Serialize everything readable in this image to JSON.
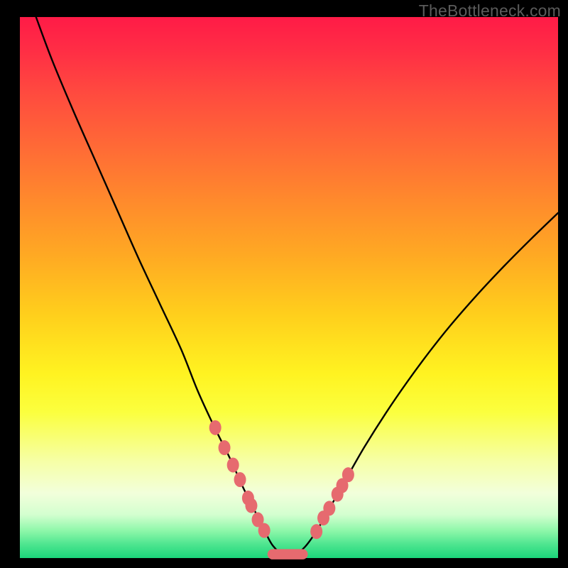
{
  "watermark": "TheBottleneck.com",
  "colors": {
    "background": "#000000",
    "curve_stroke": "#000000",
    "marker_fill": "#e66a6f",
    "gradient_stops": [
      "#ff1b47",
      "#ff2d45",
      "#ff4a3f",
      "#ff6a36",
      "#ff8a2c",
      "#ffa923",
      "#ffcf1c",
      "#fff321",
      "#fbff3e",
      "#f6ffa5",
      "#f2ffdb",
      "#d3ffcf",
      "#8cf7a9",
      "#4de58f",
      "#1bd67a"
    ]
  },
  "chart_data": {
    "type": "line",
    "title": "",
    "xlabel": "",
    "ylabel": "",
    "xlim": [
      0,
      100
    ],
    "ylim": [
      0,
      100
    ],
    "note": "Axes are unlabeled in the source image; x and y are normalized 0–100. y=0 is the bottom (green) edge, y=100 the top (red) edge.",
    "series": [
      {
        "name": "bottleneck-curve",
        "x": [
          3,
          6,
          10,
          14,
          18,
          22,
          26,
          30,
          33,
          36,
          39,
          41.5,
          43.7,
          45.5,
          47,
          49,
          51,
          53,
          55.3,
          58,
          61,
          64,
          68,
          72,
          76,
          80,
          85,
          90,
          95,
          100
        ],
        "y": [
          100,
          92,
          82.5,
          73.5,
          64.5,
          55.5,
          47,
          38.5,
          31,
          24.5,
          18.5,
          13,
          8.6,
          5,
          2.3,
          0.6,
          0.6,
          2.1,
          5.3,
          10,
          15.3,
          20.5,
          26.8,
          32.6,
          38,
          43,
          48.7,
          54,
          59,
          63.8
        ]
      }
    ],
    "markers_left": {
      "name": "left-branch-markers",
      "x": [
        36.3,
        38.0,
        39.6,
        40.9,
        42.4,
        43.0,
        44.2,
        45.4
      ],
      "y": [
        24.1,
        20.4,
        17.2,
        14.5,
        11.1,
        9.7,
        7.1,
        5.1
      ]
    },
    "markers_right": {
      "name": "right-branch-markers",
      "x": [
        55.1,
        56.4,
        57.5,
        59.0,
        59.9,
        61.0
      ],
      "y": [
        4.9,
        7.4,
        9.2,
        11.8,
        13.4,
        15.4
      ]
    },
    "trough_bar": {
      "name": "trough-bar",
      "x_start": 46.0,
      "x_end": 53.5,
      "y": 0.7,
      "thickness": 1.9
    }
  }
}
